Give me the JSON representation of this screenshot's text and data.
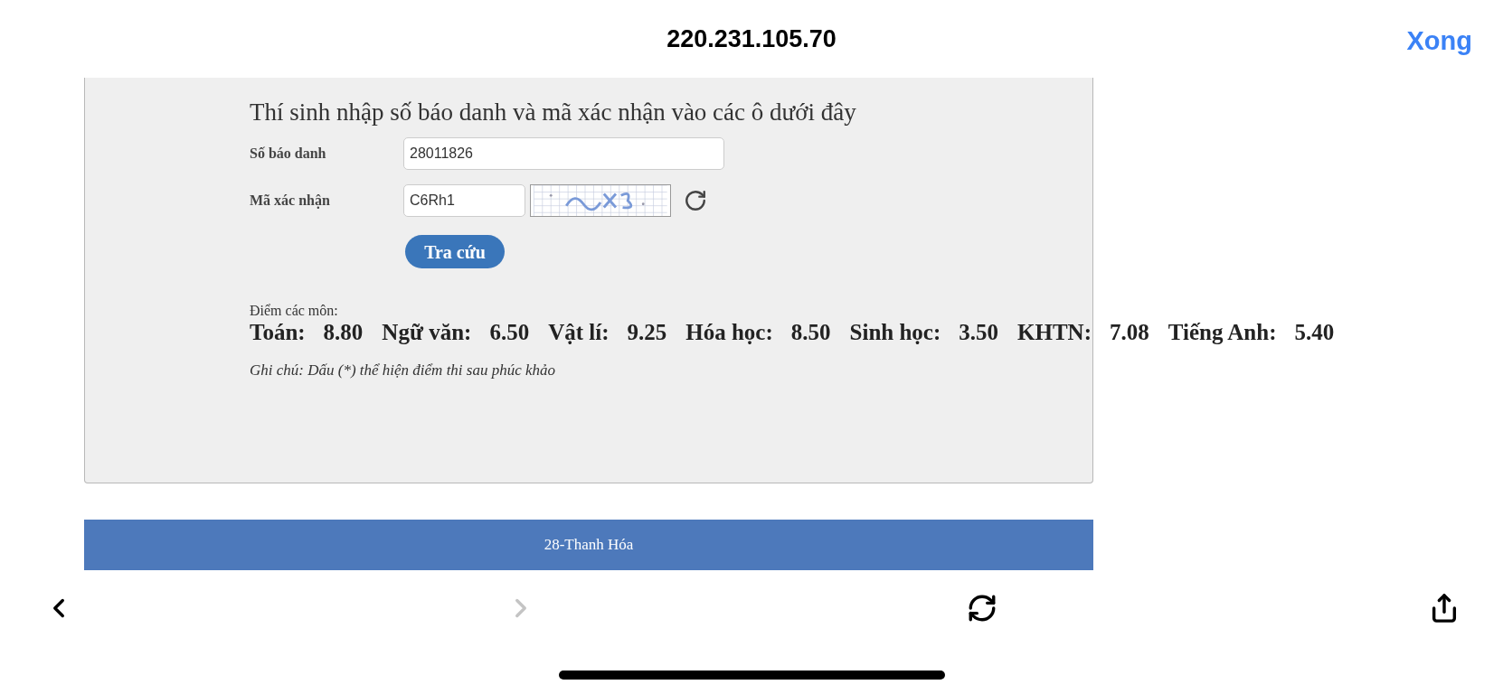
{
  "top_bar": {
    "title": "220.231.105.70",
    "done": "Xong"
  },
  "form": {
    "heading": "Thí sinh nhập số báo danh và mã xác nhận vào các ô dưới đây",
    "id_label": "Số báo danh",
    "id_value": "28011826",
    "code_label": "Mã xác nhận",
    "code_value": "C6Rh1",
    "submit": "Tra cứu"
  },
  "results": {
    "label": "Điểm các môn:",
    "scores": [
      {
        "subject": "Toán:",
        "score": "8.80"
      },
      {
        "subject": "Ngữ văn:",
        "score": "6.50"
      },
      {
        "subject": "Vật lí:",
        "score": "9.25"
      },
      {
        "subject": "Hóa học:",
        "score": "8.50"
      },
      {
        "subject": "Sinh học:",
        "score": "3.50"
      },
      {
        "subject": "KHTN:",
        "score": "7.08"
      },
      {
        "subject": "Tiếng Anh:",
        "score": "5.40"
      }
    ],
    "note": "Ghi chú: Dấu (*) thể hiện điểm thi sau phúc khảo"
  },
  "footer": {
    "text": "28-Thanh Hóa"
  },
  "toolbar": [
    {
      "kind": "back",
      "disabled": false
    },
    {
      "kind": "forward",
      "disabled": true
    },
    {
      "kind": "reload",
      "disabled": false
    },
    {
      "kind": "share",
      "disabled": false
    }
  ]
}
